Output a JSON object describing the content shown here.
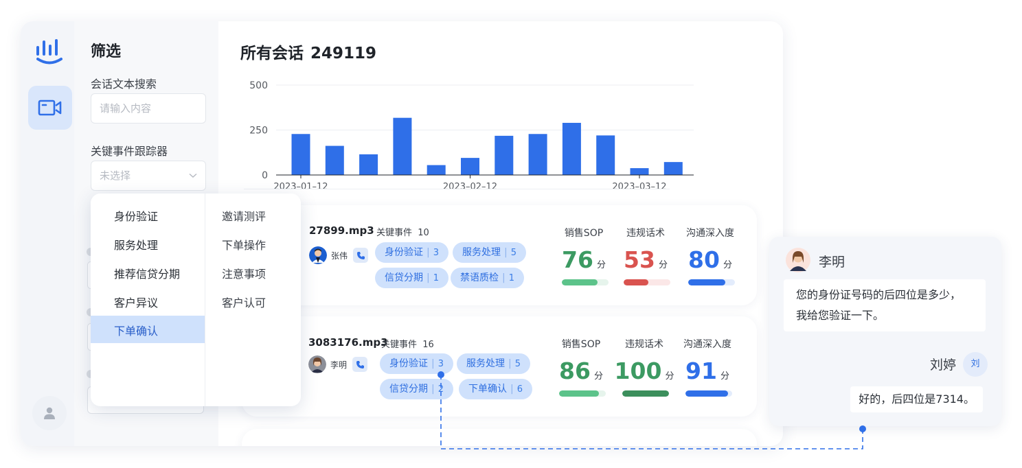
{
  "filter": {
    "title": "筛选",
    "text_search_label": "会话文本搜索",
    "text_search_placeholder": "请输入内容",
    "event_tracker_label": "关键事件跟踪器",
    "event_tracker_value": "未选择"
  },
  "dropdown": {
    "left_items": [
      "身份验证",
      "服务处理",
      "推荐信贷分期",
      "客户异议",
      "下单确认"
    ],
    "right_items": [
      "邀请测评",
      "下单操作",
      "注意事项",
      "客户认可"
    ],
    "selected": "下单确认"
  },
  "main": {
    "title": "所有会话",
    "count": "249119"
  },
  "chart_data": {
    "type": "bar",
    "ylim": [
      0,
      500
    ],
    "yticks": [
      "0",
      "250",
      "500"
    ],
    "xtick_labels": [
      "2023–01–12",
      "2023–02–12",
      "2023–03–12"
    ],
    "xtick_positions": [
      0,
      5,
      10
    ],
    "values": [
      228,
      162,
      115,
      318,
      55,
      95,
      218,
      228,
      290,
      220,
      38,
      72
    ],
    "color": "#2f6fe8",
    "grid": true
  },
  "conversations": [
    {
      "file": "27899.mp3",
      "key_events_label": "关键事件",
      "key_events_count": "10",
      "person": "张伟",
      "tags": [
        {
          "label": "身份验证",
          "count": "3"
        },
        {
          "label": "服务处理",
          "count": "5"
        },
        {
          "label": "信贷分期",
          "count": "1"
        },
        {
          "label": "禁语质检",
          "count": "1"
        }
      ],
      "metrics": [
        {
          "name": "销售SOP",
          "score": "76",
          "unit": "分",
          "fraction": 0.76,
          "color": "#3c9a62",
          "bar": "#5cc38a",
          "track": "#e6f4ec"
        },
        {
          "name": "违规话术",
          "score": "53",
          "unit": "分",
          "fraction": 0.53,
          "color": "#d9534f",
          "bar": "#d9534f",
          "track": "#fbe7e7"
        },
        {
          "name": "沟通深入度",
          "score": "80",
          "unit": "分",
          "fraction": 0.8,
          "color": "#2f6fe8",
          "bar": "#2f6fe8",
          "track": "#e3ecfc"
        }
      ]
    },
    {
      "file": "3083176.mp3",
      "key_events_label": "关键事件",
      "key_events_count": "16",
      "person": "李明",
      "tags": [
        {
          "label": "身份验证",
          "count": "3"
        },
        {
          "label": "服务处理",
          "count": "5"
        },
        {
          "label": "信贷分期",
          "count": "2"
        },
        {
          "label": "下单确认",
          "count": "6"
        }
      ],
      "metrics": [
        {
          "name": "销售SOP",
          "score": "86",
          "unit": "分",
          "fraction": 0.86,
          "color": "#3c9a62",
          "bar": "#5cc38a",
          "track": "#e6f4ec"
        },
        {
          "name": "违规话术",
          "score": "100",
          "unit": "分",
          "fraction": 1.0,
          "color": "#3c9a62",
          "bar": "#3c8f5c",
          "track": "#e6f4ec"
        },
        {
          "name": "沟通深入度",
          "score": "91",
          "unit": "分",
          "fraction": 0.91,
          "color": "#2f6fe8",
          "bar": "#2f6fe8",
          "track": "#e3ecfc"
        }
      ]
    }
  ],
  "chat": {
    "speaker1": "李明",
    "message1_line1": "您的身份证号码的后四位是多少，",
    "message1_line2": "我给您验证一下。",
    "speaker2": "刘婷",
    "speaker2_avatar": "刘",
    "message2": "好的，后四位是7314。"
  },
  "colors": {
    "accent": "#2f6fe8",
    "tag_bg": "#cfe1fc"
  }
}
